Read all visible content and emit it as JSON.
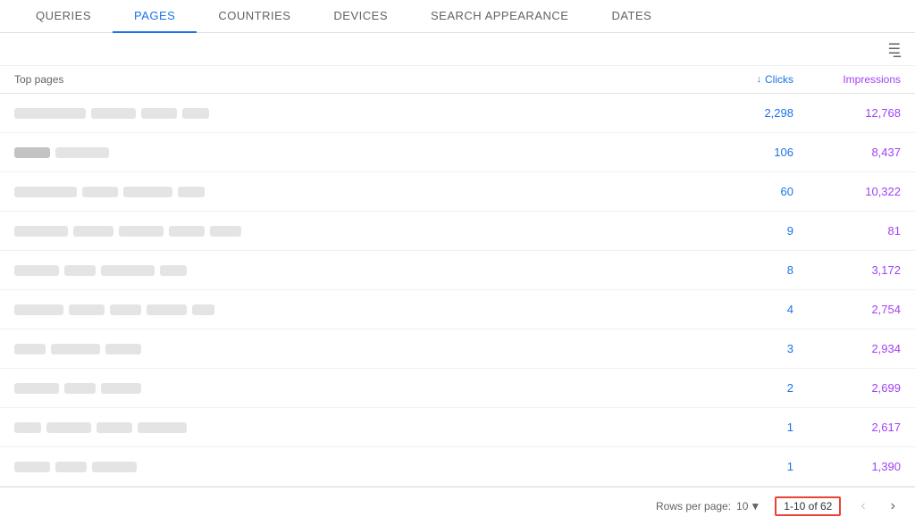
{
  "tabs": [
    {
      "id": "queries",
      "label": "QUERIES",
      "active": false
    },
    {
      "id": "pages",
      "label": "PAGES",
      "active": true
    },
    {
      "id": "countries",
      "label": "COUNTRIES",
      "active": false
    },
    {
      "id": "devices",
      "label": "DEVICES",
      "active": false
    },
    {
      "id": "search_appearance",
      "label": "SEARCH APPEARANCE",
      "active": false
    },
    {
      "id": "dates",
      "label": "DATES",
      "active": false
    }
  ],
  "header": {
    "page_col": "Top pages",
    "clicks_col": "Clicks",
    "impressions_col": "Impressions"
  },
  "rows": [
    {
      "clicks": "2,298",
      "impressions": "12,768",
      "blocks": [
        80,
        50,
        40,
        30
      ]
    },
    {
      "clicks": "106",
      "impressions": "8,437",
      "blocks": [
        40,
        60
      ],
      "dark": true
    },
    {
      "clicks": "60",
      "impressions": "10,322",
      "blocks": [
        70,
        40,
        55,
        30
      ]
    },
    {
      "clicks": "9",
      "impressions": "81",
      "blocks": [
        60,
        45,
        50,
        40,
        35
      ]
    },
    {
      "clicks": "8",
      "impressions": "3,172",
      "blocks": [
        50,
        35,
        60,
        30
      ]
    },
    {
      "clicks": "4",
      "impressions": "2,754",
      "blocks": [
        55,
        40,
        35,
        45,
        25
      ]
    },
    {
      "clicks": "3",
      "impressions": "2,934",
      "blocks": [
        35,
        55,
        40
      ]
    },
    {
      "clicks": "2",
      "impressions": "2,699",
      "blocks": [
        50,
        35,
        45
      ]
    },
    {
      "clicks": "1",
      "impressions": "2,617",
      "blocks": [
        30,
        50,
        40,
        55
      ]
    },
    {
      "clicks": "1",
      "impressions": "1,390",
      "blocks": [
        40,
        35,
        50
      ]
    }
  ],
  "footer": {
    "rows_per_page_label": "Rows per page:",
    "rows_per_page_value": "10",
    "pagination": "1-10 of 62"
  }
}
